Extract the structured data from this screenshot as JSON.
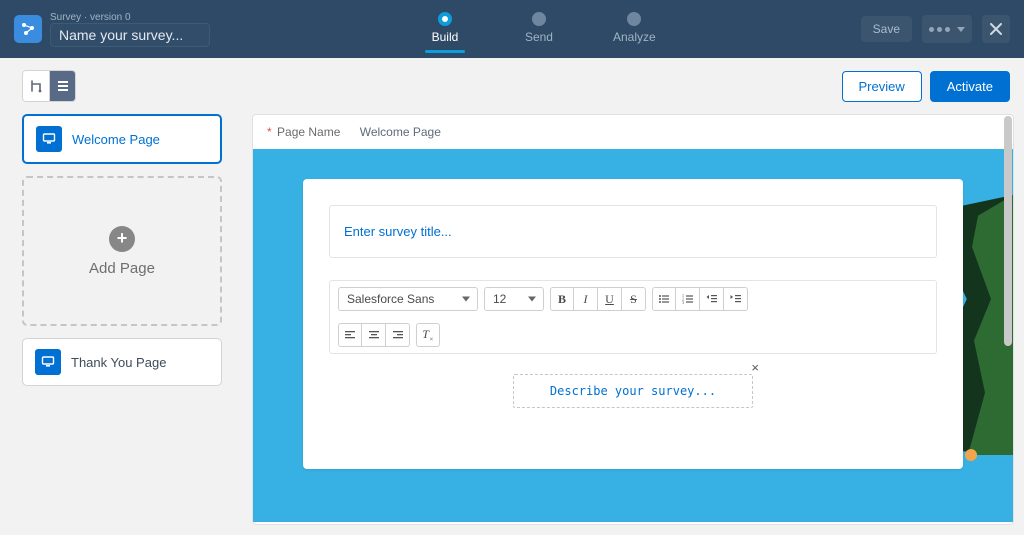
{
  "header": {
    "subtitle": "Survey · version 0",
    "survey_name_placeholder": "Name your survey...",
    "save_label": "Save"
  },
  "stepper": {
    "steps": [
      "Build",
      "Send",
      "Analyze"
    ],
    "active_index": 0
  },
  "toolbar": {
    "preview_label": "Preview",
    "activate_label": "Activate"
  },
  "sidebar": {
    "welcome_label": "Welcome Page",
    "add_page_label": "Add Page",
    "thank_you_label": "Thank You Page"
  },
  "canvas": {
    "page_name_label": "Page Name",
    "page_name_value": "Welcome Page",
    "title_placeholder": "Enter survey title...",
    "font_family": "Salesforce Sans",
    "font_size": "12",
    "describe_placeholder": "Describe your survey..."
  }
}
